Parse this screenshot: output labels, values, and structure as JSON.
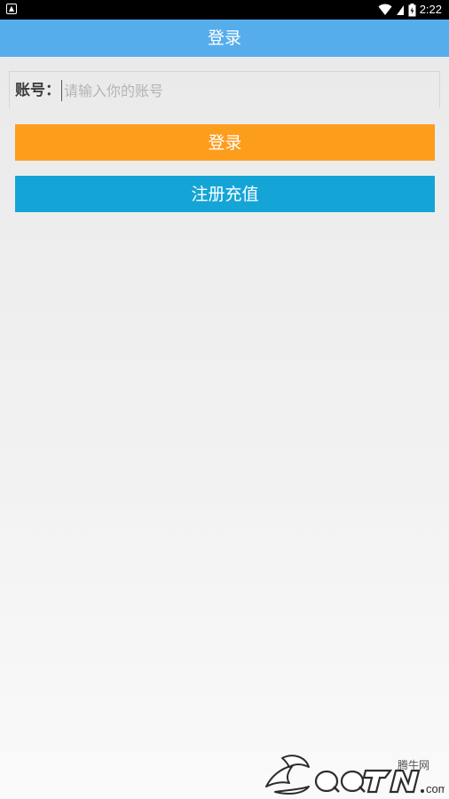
{
  "status_bar": {
    "time": "2:22",
    "notification_icon": "notification-icon",
    "wifi_icon": "wifi-icon",
    "battery_icon": "battery-icon"
  },
  "header": {
    "title": "登录",
    "background": "#56adeb"
  },
  "form": {
    "account_label": "账号：",
    "account_placeholder": "请输入你的账号",
    "account_value": ""
  },
  "buttons": {
    "login_label": "登录",
    "login_color": "#fd9d1c",
    "register_label": "注册充值",
    "register_color": "#14a5d6"
  },
  "watermark": {
    "site_cn": "腾牛网",
    "logo_text": "QQTN.com"
  }
}
